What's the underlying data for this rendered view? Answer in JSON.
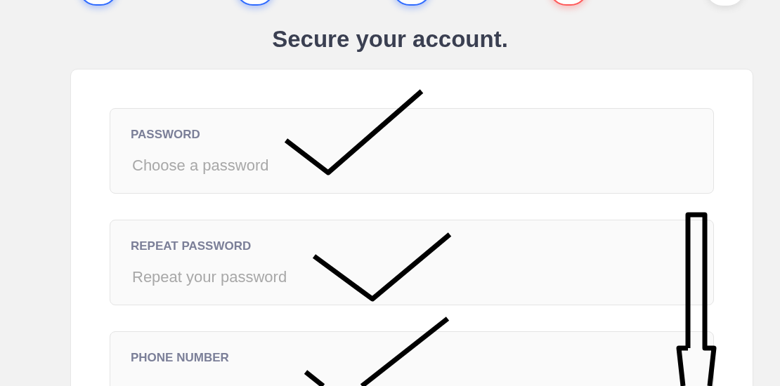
{
  "steps": [
    {
      "color": "#2f6bff"
    },
    {
      "color": "#2f6bff"
    },
    {
      "color": "#2f6bff"
    },
    {
      "color": "#ff5a5a"
    },
    {
      "color": "#ffffff"
    }
  ],
  "title": "Secure your account.",
  "fields": [
    {
      "label": "PASSWORD",
      "placeholder": "Choose a password"
    },
    {
      "label": "REPEAT PASSWORD",
      "placeholder": "Repeat your password"
    },
    {
      "label": "PHONE NUMBER"
    }
  ]
}
